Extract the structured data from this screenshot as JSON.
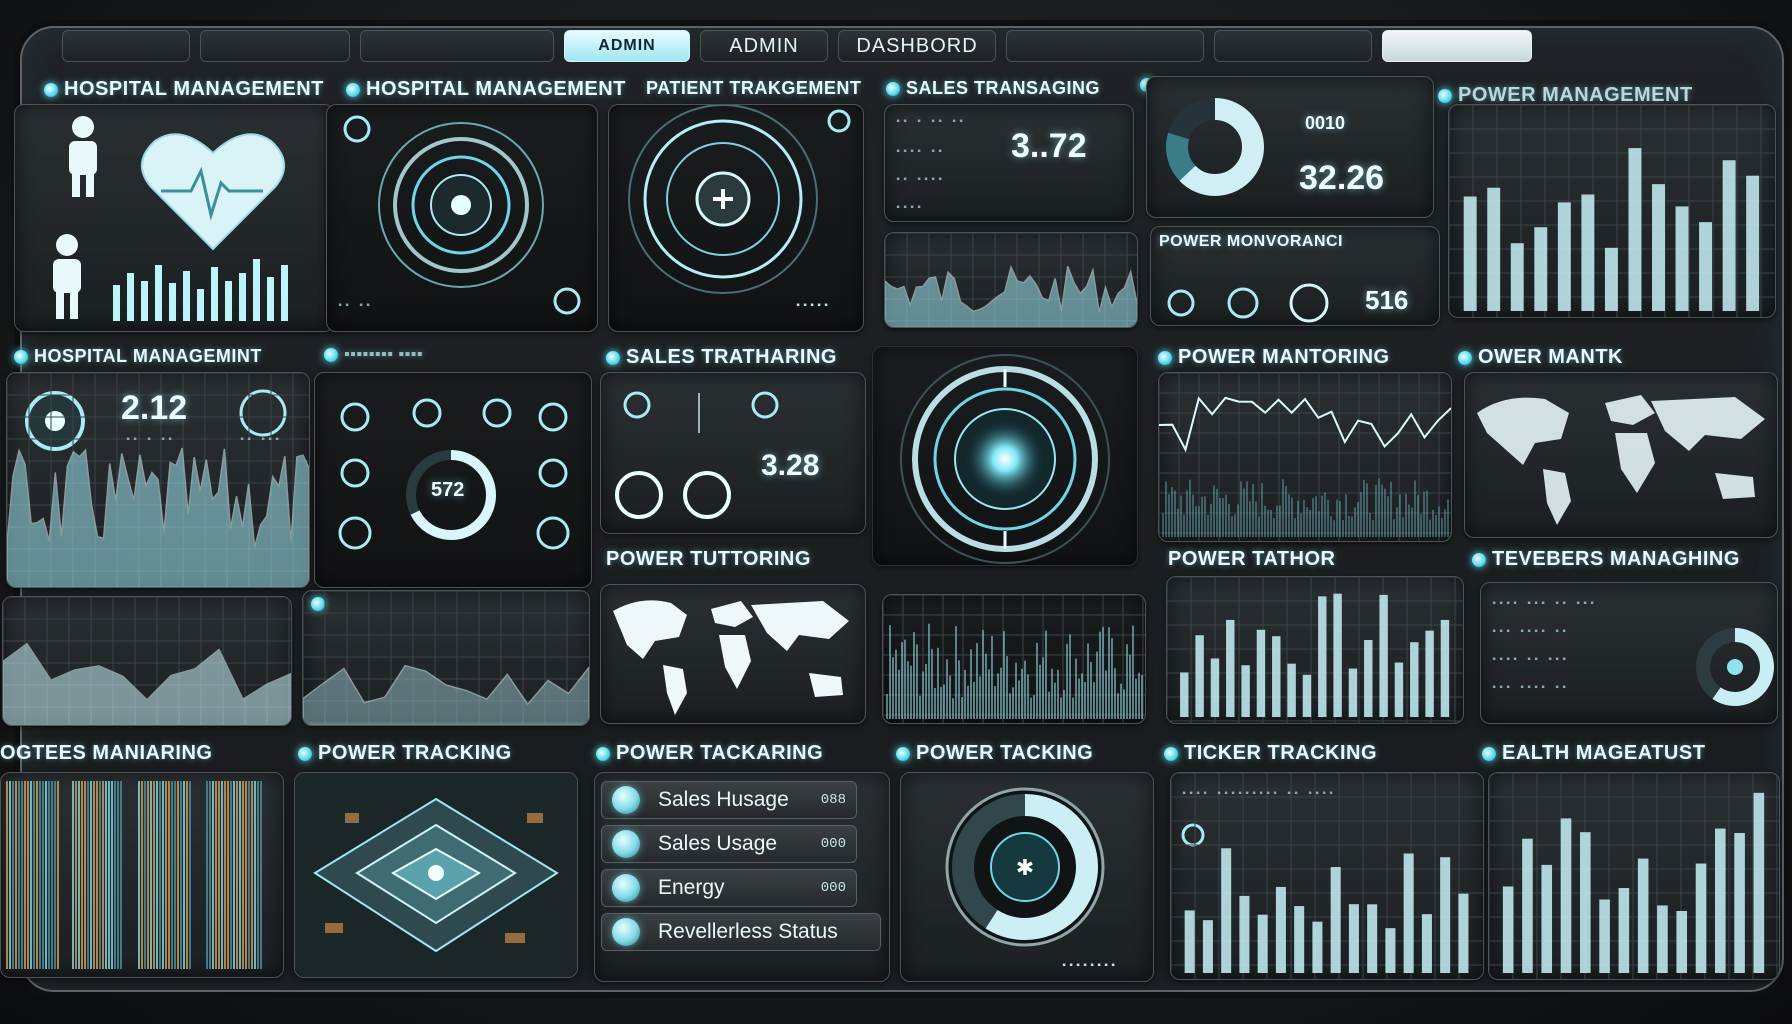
{
  "nav": {
    "tabs": [
      {
        "label": "ADMIN"
      },
      {
        "label": "ADMIN"
      },
      {
        "label": "DASHBORD"
      }
    ]
  },
  "panels": {
    "hospital_1": {
      "title": "HOSPITAL MANAGEMENT"
    },
    "hospital_2": {
      "title": "HOSPITAL MANAGEMENT"
    },
    "patient": {
      "title": "PATIENT TRAKGEMENT"
    },
    "sales_1": {
      "title": "SALES TRANSAGING",
      "value": "3..72"
    },
    "donut": {
      "value": "32.26",
      "small": "0010"
    },
    "power_mon": {
      "title": "POWER MONVORANCI",
      "value": "516"
    },
    "power_mgmt_1": {
      "title": "POWER MANAGEMENT"
    },
    "hospital_3": {
      "title": "HOSPITAL MANAGEMINT",
      "value": "2.12"
    },
    "sales_2": {
      "title": "SALES TRATHARING",
      "value": "3.28"
    },
    "ring_gauge": {
      "value": "572"
    },
    "power_mantoring": {
      "title": "POWER MANTORING"
    },
    "power_mantk": {
      "title": "OWER MANTK"
    },
    "power_tuttoring": {
      "title": "POWER TUTTORING"
    },
    "power_tathor": {
      "title": "POWER TATHOR"
    },
    "reviewers": {
      "title": "TEVEBERS MANAGHING"
    },
    "employees": {
      "title": "OGTEES MANIARING"
    },
    "power_tracking": {
      "title": "POWER TRACKING"
    },
    "power_tackaring": {
      "title": "POWER TACKARING"
    },
    "power_tacking": {
      "title": "POWER TACKING"
    },
    "ticker": {
      "title": "TICKER TRACKING"
    },
    "health": {
      "title": "EALTH MAGEATUST"
    }
  },
  "list": [
    {
      "label": "Sales Husage",
      "value": "088"
    },
    {
      "label": "Sales Usage",
      "value": "000"
    },
    {
      "label": "Energy",
      "value": "000"
    },
    {
      "label": "Revellerless Status",
      "value": ""
    }
  ],
  "colors": {
    "accent": "#6fe3f2",
    "bar": "#bdf3fb",
    "bg": "#1b1f21"
  }
}
